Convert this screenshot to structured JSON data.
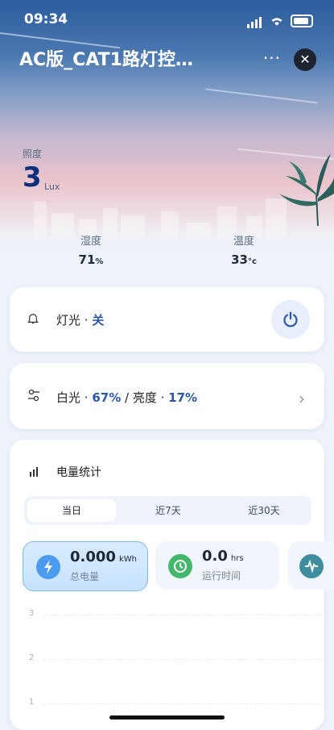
{
  "status_bar": {
    "time": "09:34"
  },
  "header": {
    "title": "AC版_CAT1路灯控…",
    "more": "···",
    "close": "✕"
  },
  "illuminance": {
    "label": "照度",
    "value": "3",
    "unit": "Lux"
  },
  "humidity": {
    "label": "湿度",
    "value": "71",
    "unit": "%"
  },
  "temperature": {
    "label": "温度",
    "value": "33",
    "unit": "°c"
  },
  "light": {
    "name": "灯光",
    "sep": " · ",
    "state": "关"
  },
  "settings": {
    "white_label": "白光",
    "white_value": "67%",
    "sep": " / ",
    "bright_label": "亮度",
    "bright_value": "17%"
  },
  "energy": {
    "title": "电量统计",
    "tabs": [
      "当日",
      "近7天",
      "近30天"
    ],
    "active_tab": 0,
    "metrics": [
      {
        "value": "0.000",
        "unit": "kWh",
        "label": "总电量",
        "color": "#4b9bf0"
      },
      {
        "value": "0.0",
        "unit": "hrs",
        "label": "运行时间",
        "color": "#43b86b"
      }
    ],
    "third_icon_color": "#3e8ea0",
    "y_ticks": [
      "3",
      "2",
      "1"
    ]
  },
  "colors": {
    "accent": "#2c57a7",
    "title_dark": "#0c2f7a"
  }
}
